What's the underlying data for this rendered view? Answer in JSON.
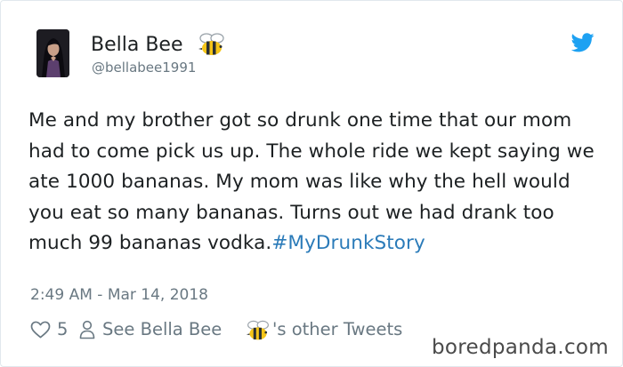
{
  "tweet": {
    "author_name": "Bella Bee",
    "handle": "@bellabee1991",
    "text": "Me and my brother got so drunk one time that our mom had to come pick us up. The whole ride we kept saying we ate 1000 bananas. My mom was like why the hell would you eat so many bananas. Turns out we had drank too much 99 bananas vodka.",
    "hashtag": "#MyDrunkStory",
    "timestamp": "2:49 AM - Mar 14, 2018",
    "like_count": "5",
    "see_label": "See Bella Bee",
    "other_tweets_label": "'s other Tweets"
  },
  "icons": {
    "emoji": "bee-emoji",
    "brand": "twitter-bird-icon",
    "like": "heart-icon",
    "profile": "person-icon"
  },
  "watermark": "boredpanda.com",
  "colors": {
    "link": "#2b7bb9",
    "twitter_blue": "#1da1f2",
    "muted": "#697882",
    "text": "#1c2022",
    "border": "#e1e8ed"
  }
}
